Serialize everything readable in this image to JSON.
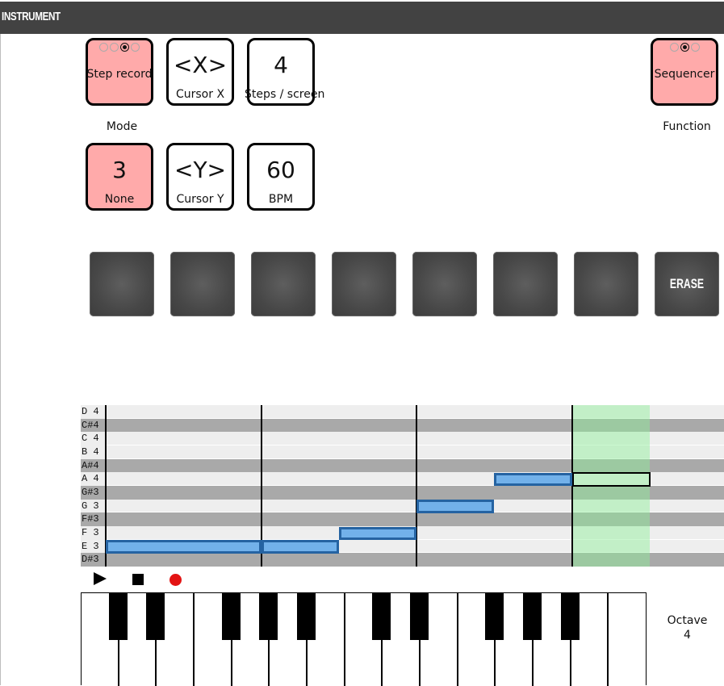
{
  "header": {
    "title": "INSTRUMENT"
  },
  "controls": {
    "mode": {
      "value": "Step record",
      "caption": "Mode",
      "options_count": 4,
      "selected_index": 2,
      "active": true
    },
    "cursor_x": {
      "value": "<X>",
      "label": "Cursor X"
    },
    "steps_per_screen": {
      "value": "4",
      "label": "Steps / screen"
    },
    "function": {
      "value": "Sequencer",
      "caption": "Function",
      "options_count": 3,
      "selected_index": 1,
      "active": true
    },
    "none_knob": {
      "value": "3",
      "label": "None",
      "active": true
    },
    "cursor_y": {
      "value": "<Y>",
      "label": "Cursor Y"
    },
    "bpm": {
      "value": "60",
      "label": "BPM"
    }
  },
  "pads": [
    {
      "label": ""
    },
    {
      "label": ""
    },
    {
      "label": ""
    },
    {
      "label": ""
    },
    {
      "label": ""
    },
    {
      "label": ""
    },
    {
      "label": ""
    },
    {
      "label": "ERASE"
    }
  ],
  "piano_roll": {
    "rows": [
      {
        "note": "D 4",
        "black": false
      },
      {
        "note": "C#4",
        "black": true
      },
      {
        "note": "C 4",
        "black": false
      },
      {
        "note": "B 4",
        "black": false
      },
      {
        "note": "A#4",
        "black": true
      },
      {
        "note": "A 4",
        "black": false
      },
      {
        "note": "G#3",
        "black": true
      },
      {
        "note": "G 3",
        "black": false
      },
      {
        "note": "F#3",
        "black": true
      },
      {
        "note": "F 3",
        "black": false
      },
      {
        "note": "E 3",
        "black": false
      },
      {
        "note": "D#3",
        "black": true
      }
    ],
    "steps_visible": 8,
    "steps_per_beat": 2,
    "notes": [
      {
        "note": "E 3",
        "start_step": 0,
        "length": 2
      },
      {
        "note": "E 3",
        "start_step": 2,
        "length": 1
      },
      {
        "note": "F 3",
        "start_step": 3,
        "length": 1
      },
      {
        "note": "G 3",
        "start_step": 4,
        "length": 1
      },
      {
        "note": "A 4",
        "start_step": 5,
        "length": 1
      }
    ],
    "cursor": {
      "step": 6,
      "note": "A 4"
    }
  },
  "transport": {
    "play": "play-icon",
    "stop": "stop-icon",
    "record": "record-icon"
  },
  "keyboard": {
    "white_keys": [
      "C",
      "D",
      "E",
      "F",
      "G",
      "A",
      "B",
      "C",
      "D",
      "E",
      "F",
      "G",
      "A",
      "B",
      "C"
    ],
    "octave_label": "Octave",
    "octave_value": "4"
  }
}
